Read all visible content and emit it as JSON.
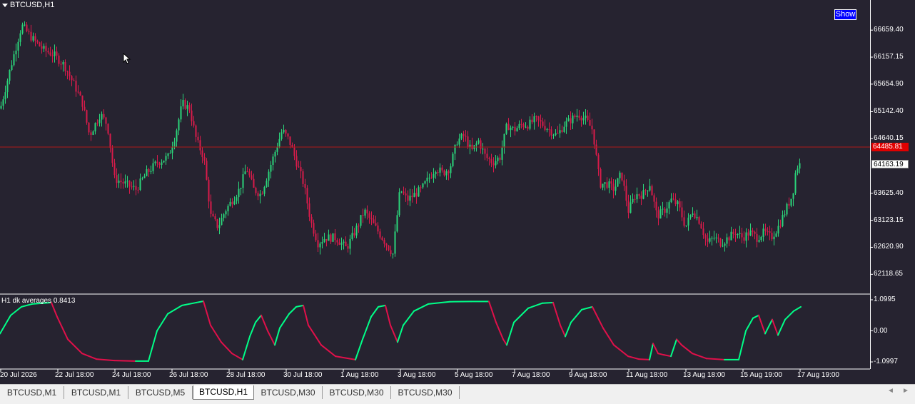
{
  "symbol_label": "BTCUSD,H1",
  "show_button": "Show",
  "indicator_label": "H1 dk averages 0.8413",
  "colors": {
    "bg": "#262330",
    "bull": "#2bd47a",
    "bear": "#d81b4a",
    "price_line": "#b01818",
    "indicator_up": "#00ff88",
    "indicator_down": "#e0104a"
  },
  "chart_data": [
    {
      "type": "candlestick",
      "symbol": "BTCUSD",
      "timeframe": "H1",
      "ylim": [
        61950,
        67100
      ],
      "y_ticks": [
        "66659.40",
        "66157.15",
        "65654.90",
        "65142.40",
        "64640.15",
        "63625.40",
        "63123.15",
        "62620.90",
        "62118.65"
      ],
      "y_tick_values": [
        66659.4,
        66157.15,
        65654.9,
        65142.4,
        64640.15,
        63625.4,
        63123.15,
        62620.9,
        62118.65
      ],
      "current_price": "64485.81",
      "current_price_value": 64485.81,
      "marker_price": "64163.19",
      "marker_price_value": 64163.19,
      "x_ticks": [
        "20 Jul 2026",
        "22 Jul 18:00",
        "24 Jul 18:00",
        "26 Jul 18:00",
        "28 Jul 18:00",
        "30 Jul 18:00",
        "1 Aug 18:00",
        "3 Aug 18:00",
        "5 Aug 18:00",
        "7 Aug 18:00",
        "9 Aug 18:00",
        "11 Aug 18:00",
        "13 Aug 18:00",
        "15 Aug 19:00",
        "17 Aug 19:00"
      ],
      "close_path": [
        [
          0,
          65200
        ],
        [
          15,
          66000
        ],
        [
          30,
          66750
        ],
        [
          45,
          66500
        ],
        [
          60,
          66300
        ],
        [
          75,
          66200
        ],
        [
          90,
          66000
        ],
        [
          105,
          65600
        ],
        [
          115,
          65300
        ],
        [
          125,
          64700
        ],
        [
          140,
          65100
        ],
        [
          150,
          64900
        ],
        [
          160,
          63900
        ],
        [
          175,
          63800
        ],
        [
          190,
          63700
        ],
        [
          205,
          64000
        ],
        [
          220,
          64200
        ],
        [
          235,
          64300
        ],
        [
          245,
          64700
        ],
        [
          255,
          65300
        ],
        [
          265,
          65200
        ],
        [
          275,
          64600
        ],
        [
          285,
          64300
        ],
        [
          295,
          63200
        ],
        [
          305,
          63000
        ],
        [
          315,
          63300
        ],
        [
          325,
          63500
        ],
        [
          335,
          63700
        ],
        [
          345,
          64100
        ],
        [
          355,
          63700
        ],
        [
          365,
          63600
        ],
        [
          375,
          64000
        ],
        [
          385,
          64400
        ],
        [
          395,
          64800
        ],
        [
          405,
          64600
        ],
        [
          415,
          64200
        ],
        [
          425,
          63800
        ],
        [
          435,
          63100
        ],
        [
          445,
          62700
        ],
        [
          455,
          62800
        ],
        [
          470,
          62800
        ],
        [
          485,
          62600
        ],
        [
          500,
          63000
        ],
        [
          510,
          63300
        ],
        [
          520,
          63100
        ],
        [
          530,
          62900
        ],
        [
          540,
          62700
        ],
        [
          550,
          62500
        ],
        [
          560,
          63700
        ],
        [
          570,
          63500
        ],
        [
          580,
          63600
        ],
        [
          590,
          63700
        ],
        [
          600,
          63900
        ],
        [
          610,
          64100
        ],
        [
          620,
          64000
        ],
        [
          630,
          64100
        ],
        [
          640,
          64600
        ],
        [
          650,
          64700
        ],
        [
          660,
          64400
        ],
        [
          670,
          64600
        ],
        [
          680,
          64300
        ],
        [
          690,
          64200
        ],
        [
          700,
          64300
        ],
        [
          710,
          64900
        ],
        [
          720,
          64800
        ],
        [
          730,
          64900
        ],
        [
          740,
          64900
        ],
        [
          750,
          65000
        ],
        [
          760,
          64900
        ],
        [
          770,
          64800
        ],
        [
          780,
          64700
        ],
        [
          790,
          64900
        ],
        [
          800,
          65000
        ],
        [
          810,
          65100
        ],
        [
          820,
          65000
        ],
        [
          830,
          64800
        ],
        [
          840,
          63800
        ],
        [
          850,
          63800
        ],
        [
          860,
          63700
        ],
        [
          870,
          64000
        ],
        [
          880,
          63300
        ],
        [
          890,
          63600
        ],
        [
          900,
          63600
        ],
        [
          910,
          63800
        ],
        [
          920,
          63200
        ],
        [
          930,
          63300
        ],
        [
          940,
          63500
        ],
        [
          950,
          63400
        ],
        [
          960,
          63000
        ],
        [
          970,
          63300
        ],
        [
          980,
          63100
        ],
        [
          990,
          62700
        ],
        [
          1000,
          62800
        ],
        [
          1010,
          62700
        ],
        [
          1020,
          62800
        ],
        [
          1030,
          62900
        ],
        [
          1040,
          62800
        ],
        [
          1050,
          62900
        ],
        [
          1060,
          62800
        ],
        [
          1070,
          62900
        ],
        [
          1080,
          62800
        ],
        [
          1090,
          63000
        ],
        [
          1100,
          63300
        ],
        [
          1110,
          63600
        ],
        [
          1115,
          64100
        ],
        [
          1120,
          64163
        ]
      ]
    },
    {
      "type": "line",
      "name": "H1 dk averages 0.8413",
      "ylim": [
        -1.1997,
        1.0995
      ],
      "y_ticks": [
        "1.0995",
        "0.00",
        "-1.0997"
      ],
      "y_tick_values": [
        1.0995,
        0.0,
        -1.0997
      ],
      "points": [
        [
          0,
          -0.1
        ],
        [
          15,
          0.55
        ],
        [
          30,
          0.85
        ],
        [
          45,
          0.95
        ],
        [
          60,
          0.98
        ],
        [
          72,
          1.0
        ],
        [
          80,
          0.5
        ],
        [
          95,
          -0.3
        ],
        [
          115,
          -0.8
        ],
        [
          135,
          -1.0
        ],
        [
          160,
          -1.05
        ],
        [
          190,
          -1.07
        ],
        [
          208,
          -1.07
        ],
        [
          220,
          0.0
        ],
        [
          235,
          0.6
        ],
        [
          255,
          0.9
        ],
        [
          275,
          1.0
        ],
        [
          285,
          1.05
        ],
        [
          295,
          0.2
        ],
        [
          310,
          -0.4
        ],
        [
          325,
          -0.8
        ],
        [
          340,
          -1.02
        ],
        [
          350,
          -0.2
        ],
        [
          358,
          0.3
        ],
        [
          366,
          0.55
        ],
        [
          375,
          0.0
        ],
        [
          385,
          -0.5
        ],
        [
          392,
          0.1
        ],
        [
          405,
          0.6
        ],
        [
          415,
          0.85
        ],
        [
          425,
          0.9
        ],
        [
          432,
          0.2
        ],
        [
          450,
          -0.5
        ],
        [
          470,
          -0.9
        ],
        [
          498,
          -1.02
        ],
        [
          508,
          -0.3
        ],
        [
          520,
          0.5
        ],
        [
          530,
          0.85
        ],
        [
          540,
          0.9
        ],
        [
          547,
          0.2
        ],
        [
          557,
          -0.4
        ],
        [
          565,
          0.2
        ],
        [
          580,
          0.7
        ],
        [
          600,
          0.95
        ],
        [
          630,
          1.03
        ],
        [
          660,
          1.04
        ],
        [
          685,
          1.04
        ],
        [
          695,
          0.3
        ],
        [
          705,
          -0.3
        ],
        [
          710,
          -0.5
        ],
        [
          720,
          0.3
        ],
        [
          740,
          0.8
        ],
        [
          760,
          0.98
        ],
        [
          775,
          1.0
        ],
        [
          785,
          0.2
        ],
        [
          792,
          -0.2
        ],
        [
          800,
          0.3
        ],
        [
          815,
          0.75
        ],
        [
          830,
          0.85
        ],
        [
          845,
          0.1
        ],
        [
          860,
          -0.5
        ],
        [
          880,
          -0.9
        ],
        [
          895,
          -1.0
        ],
        [
          910,
          -1.02
        ],
        [
          915,
          -0.45
        ],
        [
          922,
          -0.8
        ],
        [
          930,
          -0.85
        ],
        [
          940,
          -0.9
        ],
        [
          948,
          -0.3
        ],
        [
          955,
          -0.5
        ],
        [
          970,
          -0.8
        ],
        [
          990,
          -0.98
        ],
        [
          1015,
          -1.02
        ],
        [
          1035,
          -1.02
        ],
        [
          1045,
          0.0
        ],
        [
          1055,
          0.45
        ],
        [
          1063,
          0.55
        ],
        [
          1072,
          -0.1
        ],
        [
          1082,
          0.4
        ],
        [
          1090,
          -0.15
        ],
        [
          1100,
          0.4
        ],
        [
          1112,
          0.7
        ],
        [
          1122,
          0.85
        ]
      ]
    }
  ],
  "tabs": [
    {
      "label": "BTCUSD,M1",
      "active": false
    },
    {
      "label": "BTCUSD,M1",
      "active": false
    },
    {
      "label": "BTCUSD,M5",
      "active": false
    },
    {
      "label": "BTCUSD,H1",
      "active": true
    },
    {
      "label": "BTCUSD,M30",
      "active": false
    },
    {
      "label": "BTCUSD,M30",
      "active": false
    },
    {
      "label": "BTCUSD,M30",
      "active": false
    }
  ]
}
